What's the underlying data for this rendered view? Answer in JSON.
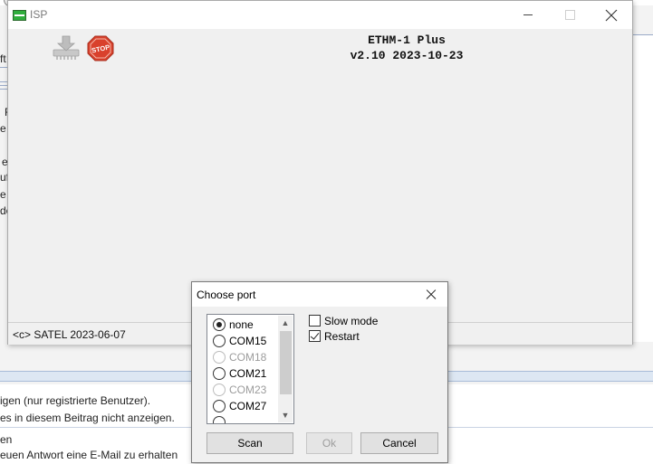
{
  "background": {
    "fragments": [
      "ft",
      "F",
      "e",
      "e",
      "uf",
      "e",
      "de"
    ],
    "line1": "igen (nur registrierte Benutzer).",
    "line2": "es in diesem Beitrag nicht anzeigen.",
    "line3": "en",
    "line4": "euen Antwort eine E-Mail zu erhalten"
  },
  "isp_window": {
    "title": "ISP",
    "device_name": "ETHM-1 Plus",
    "device_version": "v2.10 2023-10-23",
    "status": "<c> SATEL 2023-06-07",
    "tool_icons": [
      "download-icon",
      "stop-icon"
    ]
  },
  "dialog": {
    "title": "Choose port",
    "ports": [
      {
        "label": "none",
        "selected": true,
        "enabled": true
      },
      {
        "label": "COM15",
        "selected": false,
        "enabled": true
      },
      {
        "label": "COM18",
        "selected": false,
        "enabled": false
      },
      {
        "label": "COM21",
        "selected": false,
        "enabled": true
      },
      {
        "label": "COM23",
        "selected": false,
        "enabled": false
      },
      {
        "label": "COM27",
        "selected": false,
        "enabled": true
      }
    ],
    "slow_mode": {
      "label": "Slow mode",
      "checked": false
    },
    "restart": {
      "label": "Restart",
      "checked": true
    },
    "buttons": {
      "scan": "Scan",
      "ok": "Ok",
      "cancel": "Cancel"
    }
  },
  "colors": {
    "stop_sign": "#d9412c",
    "app_icon": "#2fae3d"
  }
}
